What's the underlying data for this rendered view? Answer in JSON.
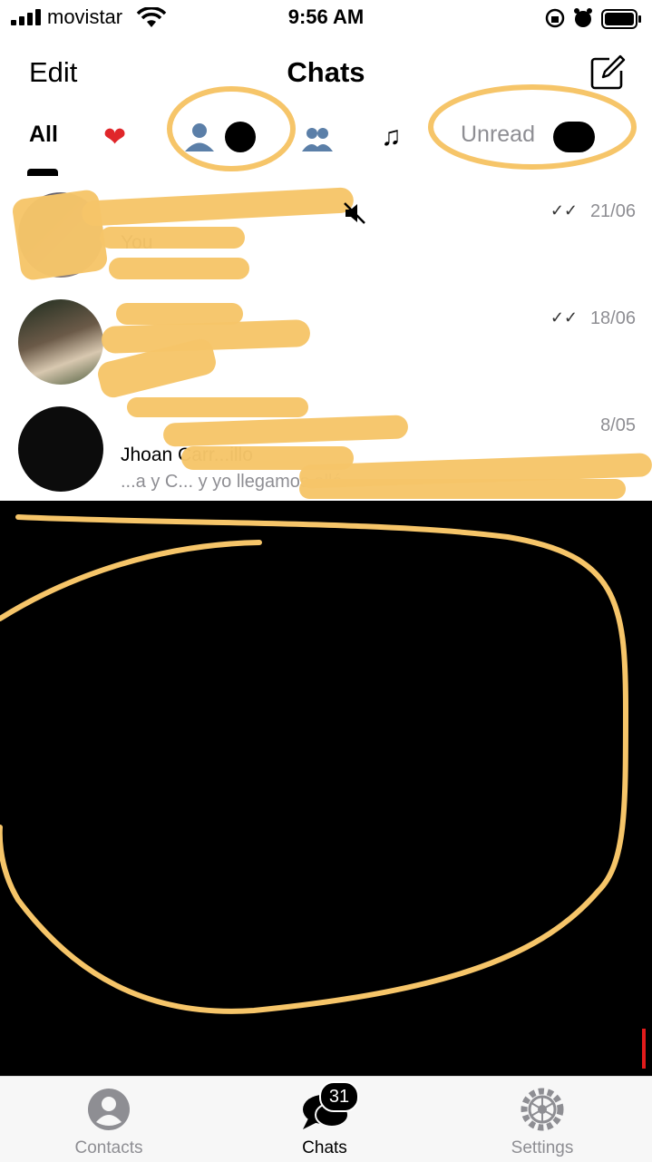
{
  "status_bar": {
    "carrier": "movistar",
    "time": "9:56 AM"
  },
  "nav": {
    "edit_label": "Edit",
    "title": "Chats"
  },
  "filters": {
    "all_label": "All",
    "unread_label": "Unread",
    "icons": [
      "heart-icon",
      "person-icon",
      "group-icon",
      "music-note-icon"
    ]
  },
  "chats": [
    {
      "name": "",
      "subtitle": "You",
      "preview": "",
      "date": "21/06",
      "read_ticks": "✓✓"
    },
    {
      "name": "",
      "subtitle": "",
      "preview": "",
      "date": "18/06",
      "read_ticks": "✓✓"
    },
    {
      "name": "",
      "subtitle": "Jhoan Carr...illo",
      "preview": "...a y C... y yo llegamos allá",
      "date": "8/05",
      "read_ticks": ""
    }
  ],
  "tabbar": {
    "items": [
      {
        "label": "Contacts",
        "icon": "person-circle-icon"
      },
      {
        "label": "Chats",
        "icon": "chat-bubbles-icon"
      },
      {
        "label": "Settings",
        "icon": "gear-icon"
      }
    ],
    "chats_badge": "31"
  },
  "colors": {
    "annotation": "#f6c569",
    "inactive_gray": "#8e8e93"
  }
}
